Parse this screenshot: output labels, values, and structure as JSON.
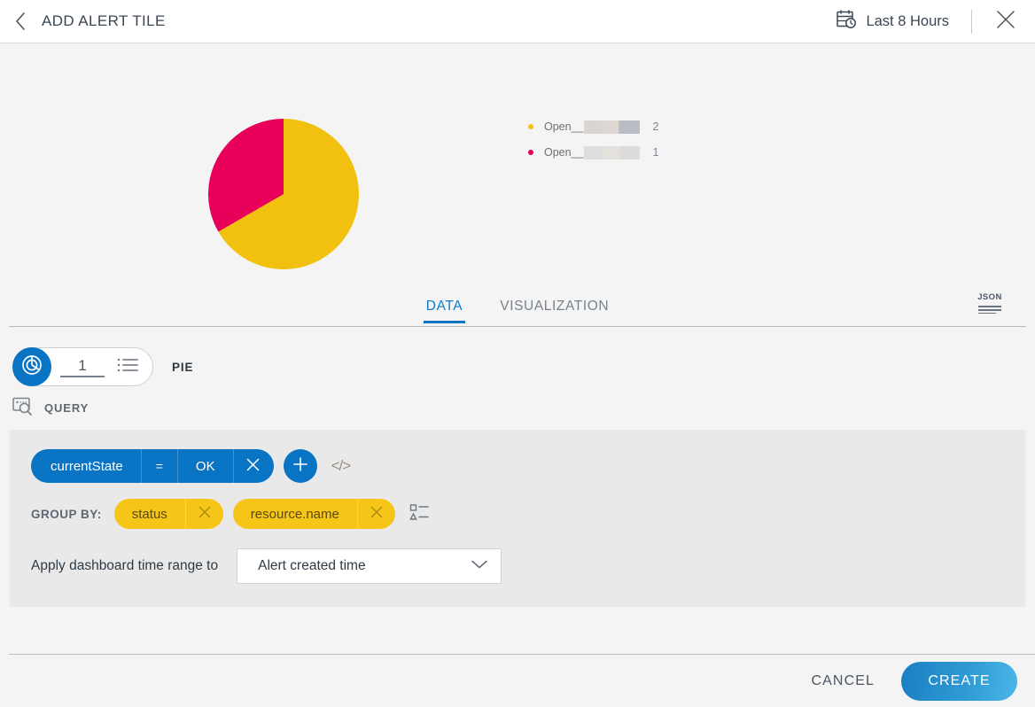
{
  "header": {
    "back_icon": "chevron-left-icon",
    "title": "ADD ALERT TILE",
    "time_range_icon": "calendar-clock-icon",
    "time_range_label": "Last 8 Hours",
    "close_icon": "close-icon"
  },
  "preview": {
    "legend": [
      {
        "label": "Open__",
        "value": "2",
        "color": "#F2C00E",
        "redacted": true
      },
      {
        "label": "Open__",
        "value": "1",
        "color": "#E8005A",
        "redacted": true
      }
    ]
  },
  "chart_data": {
    "type": "pie",
    "title": "",
    "categories": [
      "Open__",
      "Open__"
    ],
    "values": [
      2,
      1
    ],
    "colors": [
      "#F2C00E",
      "#E8005A"
    ],
    "legend_position": "right",
    "total": 3,
    "start_angle_deg": 0
  },
  "tabs": {
    "items": [
      {
        "label": "DATA",
        "active": true
      },
      {
        "label": "VISUALIZATION",
        "active": false
      }
    ],
    "json_button_label": "JSON",
    "json_icon": "json-lines-icon"
  },
  "series": {
    "chart_icon": "pie-chart-icon",
    "index_label": "1",
    "list_icon": "list-icon",
    "type_label": "PIE"
  },
  "query": {
    "section_icon": "query-search-icon",
    "section_label": "QUERY",
    "filter": {
      "field": "currentState",
      "operator": "=",
      "value": "OK",
      "remove_icon": "close-icon"
    },
    "add_filter_icon": "plus-icon",
    "code_view_icon": "code-icon",
    "code_view_label": "</>",
    "group_by_label": "GROUP BY:",
    "group_by_pills": [
      {
        "label": "status",
        "remove_icon": "close-icon"
      },
      {
        "label": "resource.name",
        "remove_icon": "close-icon"
      }
    ],
    "sort_icon": "sort-icon",
    "time_range_row": {
      "label": "Apply dashboard time range to",
      "selected": "Alert created time",
      "chevron_icon": "chevron-down-icon"
    }
  },
  "footer": {
    "cancel_label": "CANCEL",
    "create_label": "CREATE"
  },
  "colors": {
    "accent_blue": "#0a74c4",
    "gold": "#F2C00E",
    "crimson": "#E8005A",
    "pill_yellow": "#f5c518",
    "page_bg": "#f4f4f4",
    "panel_bg": "#e9e9e9"
  }
}
